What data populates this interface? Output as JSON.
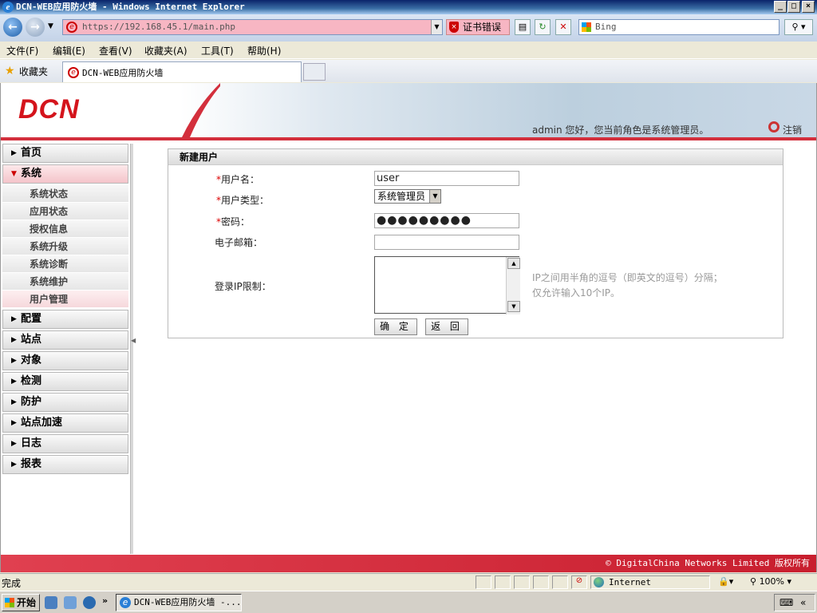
{
  "window": {
    "title": "DCN-WEB应用防火墙 - Windows Internet Explorer"
  },
  "browser": {
    "url": "https://192.168.45.1/main.php",
    "cert_error": "证书错误",
    "search_placeholder": "Bing",
    "menu": [
      "文件(F)",
      "编辑(E)",
      "查看(V)",
      "收藏夹(A)",
      "工具(T)",
      "帮助(H)"
    ],
    "favorites_label": "收藏夹",
    "tab_title": "DCN-WEB应用防火墙"
  },
  "header": {
    "logo": "DCN",
    "welcome": "admin 您好，您当前角色是系统管理员。",
    "logout": "注销"
  },
  "sidebar": {
    "items": [
      {
        "label": "首页",
        "expanded": false
      },
      {
        "label": "系统",
        "expanded": true
      },
      {
        "label": "配置",
        "expanded": false
      },
      {
        "label": "站点",
        "expanded": false
      },
      {
        "label": "对象",
        "expanded": false
      },
      {
        "label": "检测",
        "expanded": false
      },
      {
        "label": "防护",
        "expanded": false
      },
      {
        "label": "站点加速",
        "expanded": false
      },
      {
        "label": "日志",
        "expanded": false
      },
      {
        "label": "报表",
        "expanded": false
      }
    ],
    "system_subitems": [
      "系统状态",
      "应用状态",
      "授权信息",
      "系统升级",
      "系统诊断",
      "系统维护",
      "用户管理"
    ],
    "active_subitem": "用户管理"
  },
  "form": {
    "title": "新建用户",
    "required_mark": "*",
    "username_label": "用户名：",
    "username_value": "user",
    "usertype_label": "用户类型：",
    "usertype_value": "系统管理员",
    "password_label": "密码：",
    "password_value": "●●●●●●●●●",
    "email_label": "电子邮箱：",
    "email_value": "",
    "ip_label": "登录IP限制：",
    "ip_value": "",
    "ip_hint_line1": "IP之间用半角的逗号（即英文的逗号）分隔；",
    "ip_hint_line2": "仅允许输入10个IP。",
    "confirm": "确 定",
    "back": "返 回"
  },
  "footer": {
    "copyright": "© DigitalChina Networks Limited 版权所有"
  },
  "statusbar": {
    "text": "完成",
    "zone": "Internet",
    "zoom": "100%"
  },
  "taskbar": {
    "start": "开始",
    "task": "DCN-WEB应用防火墙 -..."
  }
}
